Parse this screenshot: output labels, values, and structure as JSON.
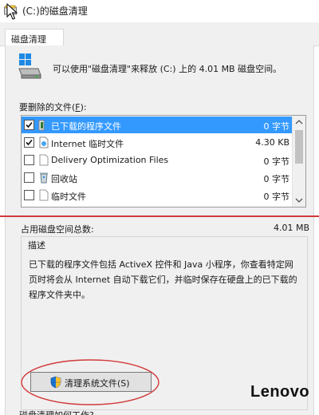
{
  "window": {
    "title": "(C:)的磁盘清理"
  },
  "tabs": [
    {
      "label": "磁盘清理",
      "active": true
    }
  ],
  "intro": {
    "text": "可以使用\"磁盘清理\"来释放 (C:) 上的 4.01 MB 磁盘空间。",
    "icon": "drive-cleanup-icon"
  },
  "files": {
    "label_prefix": "要删除的文件(",
    "label_key": "F",
    "label_suffix": "):",
    "items": [
      {
        "name": "已下载的程序文件",
        "size": "0 字节",
        "checked": true,
        "selected": true,
        "icon": "folder-icon"
      },
      {
        "name": "Internet 临时文件",
        "size": "4.30 KB",
        "checked": true,
        "selected": false,
        "icon": "internet-files-icon"
      },
      {
        "name": "Delivery Optimization Files",
        "size": "0 字节",
        "checked": false,
        "selected": false,
        "icon": "file-icon"
      },
      {
        "name": "回收站",
        "size": "0 字节",
        "checked": false,
        "selected": false,
        "icon": "recycle-bin-icon"
      },
      {
        "name": "临时文件",
        "size": "0 字节",
        "checked": false,
        "selected": false,
        "icon": "file-icon"
      }
    ]
  },
  "total": {
    "label": "占用磁盘空间总数:",
    "value": "4.01 MB"
  },
  "description": {
    "legend": "描述",
    "text": "已下载的程序文件包括 ActiveX 控件和 Java 小程序，你查看特定网页时将会从 Internet 自动下载它们，并临时保存在硬盘上的已下载的程序文件夹中。"
  },
  "clean_button": {
    "label": "清理系统文件(S)"
  },
  "bottom_link": {
    "text": "磁盘清理如何工作?"
  },
  "watermark": {
    "text": "Lenovo"
  },
  "colors": {
    "selection": "#3399ff",
    "annotation_red": "#d23a3a",
    "panel_bg": "#f0f0f0"
  }
}
